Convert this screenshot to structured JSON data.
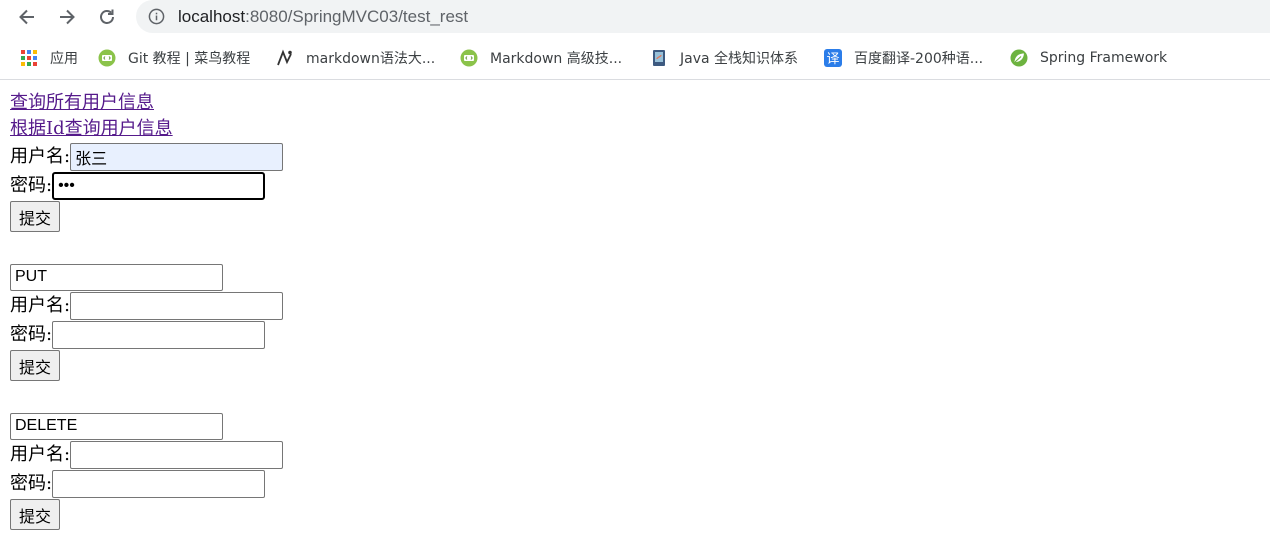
{
  "browser": {
    "back_icon": "arrow-left-icon",
    "forward_icon": "arrow-right-icon",
    "reload_icon": "reload-icon",
    "url_host": "localhost",
    "url_path": ":8080/SpringMVC03/test_rest"
  },
  "bookmarks": [
    {
      "label": "应用",
      "icon": "apps-grid-icon"
    },
    {
      "label": "Git 教程 | 菜鸟教程",
      "icon": "runoob-icon"
    },
    {
      "label": "markdown语法大...",
      "icon": "markdown-site-icon"
    },
    {
      "label": "Markdown 高级技...",
      "icon": "runoob-icon"
    },
    {
      "label": "Java 全栈知识体系",
      "icon": "java-book-icon"
    },
    {
      "label": "百度翻译-200种语...",
      "icon": "translate-icon"
    },
    {
      "label": "Spring Framework",
      "icon": "spring-leaf-icon"
    }
  ],
  "links": {
    "all_users": "查询所有用户信息",
    "user_by_id": "根据Id查询用户信息"
  },
  "post_form": {
    "username_label": "用户名:",
    "username_value": "张三",
    "password_label": "密码:",
    "password_value": "•••",
    "submit_label": "提交"
  },
  "put_form": {
    "method_value": "PUT",
    "username_label": "用户名:",
    "username_value": "",
    "password_label": "密码:",
    "password_value": "",
    "submit_label": "提交"
  },
  "delete_form": {
    "method_value": "DELETE",
    "username_label": "用户名:",
    "username_value": "",
    "password_label": "密码:",
    "password_value": "",
    "submit_label": "提交"
  },
  "colors": {
    "link_visited": "#551a8b",
    "autofill_bg": "#e8f0fe",
    "omnibox_bg": "#f1f3f4"
  }
}
